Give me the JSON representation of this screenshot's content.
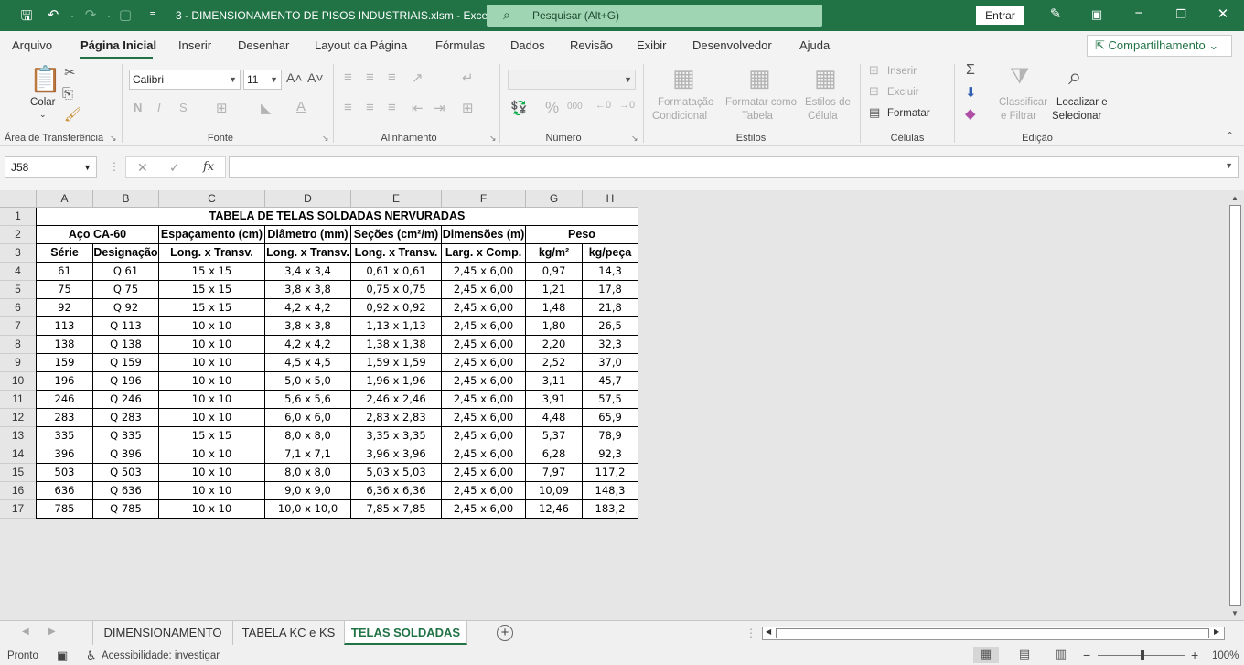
{
  "titlebar": {
    "doc_title": "3 - DIMENSIONAMENTO DE PISOS INDUSTRIAIS.xlsm  -  Excel",
    "search_placeholder": "Pesquisar (Alt+G)",
    "signin_label": "Entrar"
  },
  "menu": {
    "tabs": [
      "Arquivo",
      "Página Inicial",
      "Inserir",
      "Desenhar",
      "Layout da Página",
      "Fórmulas",
      "Dados",
      "Revisão",
      "Exibir",
      "Desenvolvedor",
      "Ajuda"
    ],
    "active_tab": "Página Inicial",
    "share_label": "Compartilhamento"
  },
  "ribbon": {
    "clipboard": {
      "paste_label": "Colar",
      "group_label": "Área de Transferência"
    },
    "font": {
      "font_name": "Calibri",
      "font_size": "11",
      "group_label": "Fonte"
    },
    "alignment": {
      "group_label": "Alinhamento"
    },
    "number": {
      "group_label": "Número"
    },
    "styles": {
      "conditional_line1": "Formatação",
      "conditional_line2": "Condicional",
      "table_line1": "Formatar como",
      "table_line2": "Tabela",
      "cell_styles_line1": "Estilos de",
      "cell_styles_line2": "Célula",
      "group_label": "Estilos"
    },
    "cells": {
      "insert_label": "Inserir",
      "delete_label": "Excluir",
      "format_label": "Formatar",
      "group_label": "Células"
    },
    "editing": {
      "sort_line1": "Classificar",
      "sort_line2": "e Filtrar",
      "find_line1": "Localizar e",
      "find_line2": "Selecionar",
      "group_label": "Edição"
    }
  },
  "formula_bar": {
    "name_box": "J58",
    "fx_label": "fx",
    "formula": ""
  },
  "sheet": {
    "columns": [
      "A",
      "B",
      "C",
      "D",
      "E",
      "F",
      "G",
      "H"
    ],
    "rows": [
      "1",
      "2",
      "3",
      "4",
      "5",
      "6",
      "7",
      "8",
      "9",
      "10",
      "11",
      "12",
      "13",
      "14",
      "15",
      "16",
      "17"
    ],
    "table_title": "TABELA DE TELAS SOLDADAS NERVURADAS",
    "group_headers": {
      "aco": "Aço CA-60",
      "espacamento": "Espaçamento (cm)",
      "diametro": "Diâmetro (mm)",
      "secoes": "Seções (cm²/m)",
      "dimensoes": "Dimensões (m)",
      "peso": "Peso"
    },
    "sub_headers": [
      "Série",
      "Designação",
      "Long. x Transv.",
      "Long. x Transv.",
      "Long. x Transv.",
      "Larg. x Comp.",
      "kg/m²",
      "kg/peça"
    ],
    "data": [
      [
        "61",
        "Q 61",
        "15 x 15",
        "3,4 x 3,4",
        "0,61 x 0,61",
        "2,45 x 6,00",
        "0,97",
        "14,3"
      ],
      [
        "75",
        "Q 75",
        "15 x 15",
        "3,8 x 3,8",
        "0,75 x 0,75",
        "2,45 x 6,00",
        "1,21",
        "17,8"
      ],
      [
        "92",
        "Q 92",
        "15 x 15",
        "4,2 x 4,2",
        "0,92 x 0,92",
        "2,45 x 6,00",
        "1,48",
        "21,8"
      ],
      [
        "113",
        "Q 113",
        "10 x 10",
        "3,8 x 3,8",
        "1,13 x 1,13",
        "2,45 x 6,00",
        "1,80",
        "26,5"
      ],
      [
        "138",
        "Q 138",
        "10 x 10",
        "4,2 x 4,2",
        "1,38 x 1,38",
        "2,45 x 6,00",
        "2,20",
        "32,3"
      ],
      [
        "159",
        "Q 159",
        "10 x 10",
        "4,5 x 4,5",
        "1,59 x 1,59",
        "2,45 x 6,00",
        "2,52",
        "37,0"
      ],
      [
        "196",
        "Q 196",
        "10 x 10",
        "5,0 x 5,0",
        "1,96 x 1,96",
        "2,45 x 6,00",
        "3,11",
        "45,7"
      ],
      [
        "246",
        "Q 246",
        "10 x 10",
        "5,6 x 5,6",
        "2,46 x 2,46",
        "2,45 x 6,00",
        "3,91",
        "57,5"
      ],
      [
        "283",
        "Q 283",
        "10 x 10",
        "6,0 x 6,0",
        "2,83 x 2,83",
        "2,45 x 6,00",
        "4,48",
        "65,9"
      ],
      [
        "335",
        "Q 335",
        "15 x 15",
        "8,0 x 8,0",
        "3,35 x 3,35",
        "2,45 x 6,00",
        "5,37",
        "78,9"
      ],
      [
        "396",
        "Q 396",
        "10 x 10",
        "7,1 x 7,1",
        "3,96 x 3,96",
        "2,45 x 6,00",
        "6,28",
        "92,3"
      ],
      [
        "503",
        "Q 503",
        "10 x 10",
        "8,0 x 8,0",
        "5,03 x 5,03",
        "2,45 x 6,00",
        "7,97",
        "117,2"
      ],
      [
        "636",
        "Q 636",
        "10 x 10",
        "9,0 x 9,0",
        "6,36 x 6,36",
        "2,45 x 6,00",
        "10,09",
        "148,3"
      ],
      [
        "785",
        "Q 785",
        "10 x 10",
        "10,0 x 10,0",
        "7,85 x 7,85",
        "2,45 x 6,00",
        "12,46",
        "183,2"
      ]
    ]
  },
  "sheet_tabs": {
    "tabs": [
      "DIMENSIONAMENTO",
      "TABELA KC e KS",
      "TELAS SOLDADAS"
    ],
    "active": "TELAS SOLDADAS"
  },
  "status": {
    "ready": "Pronto",
    "accessibility": "Acessibilidade: investigar",
    "zoom": "100%"
  },
  "colors": {
    "accent": "#217346",
    "search": "#9fd5b2"
  }
}
